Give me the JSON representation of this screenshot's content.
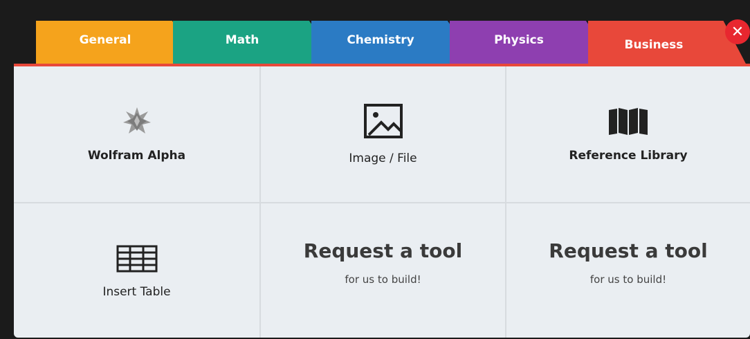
{
  "tabs": [
    {
      "label": "General",
      "color": "#f5a31c"
    },
    {
      "label": "Math",
      "color": "#1ba383"
    },
    {
      "label": "Chemistry",
      "color": "#2b7bc4"
    },
    {
      "label": "Physics",
      "color": "#8e3fb0"
    },
    {
      "label": "Business",
      "color": "#e8483a",
      "active": true
    }
  ],
  "close": {
    "label": "✕",
    "color": "#e8272f"
  },
  "tools": {
    "wolfram": {
      "label": "Wolfram Alpha",
      "icon": "wolfram-alpha-icon"
    },
    "image": {
      "label": "Image / File",
      "icon": "image-icon"
    },
    "reference": {
      "label": "Reference Library",
      "icon": "book-icon"
    },
    "table": {
      "label": "Insert Table",
      "icon": "table-icon"
    },
    "request1": {
      "title": "Request a tool",
      "subtitle": "for us to build!"
    },
    "request2": {
      "title": "Request a tool",
      "subtitle": "for us to build!"
    }
  }
}
